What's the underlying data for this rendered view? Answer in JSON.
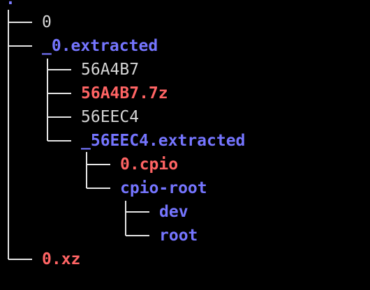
{
  "tree": {
    "root": ".",
    "nodes": [
      {
        "id": "n0",
        "name": "0",
        "kind": "file"
      },
      {
        "id": "n1",
        "name": "_0.extracted",
        "kind": "dir"
      },
      {
        "id": "n2",
        "name": "56A4B7",
        "kind": "file"
      },
      {
        "id": "n3",
        "name": "56A4B7.7z",
        "kind": "archive"
      },
      {
        "id": "n4",
        "name": "56EEC4",
        "kind": "file"
      },
      {
        "id": "n5",
        "name": "_56EEC4.extracted",
        "kind": "dir"
      },
      {
        "id": "n6",
        "name": "0.cpio",
        "kind": "archive"
      },
      {
        "id": "n7",
        "name": "cpio-root",
        "kind": "dir"
      },
      {
        "id": "n8",
        "name": "dev",
        "kind": "dir"
      },
      {
        "id": "n9",
        "name": "root",
        "kind": "dir"
      },
      {
        "id": "n10",
        "name": "0.xz",
        "kind": "archive"
      }
    ]
  },
  "colors": {
    "background": "#000000",
    "file": "#d4d4d4",
    "dir": "#7575ff",
    "archive": "#ff6464",
    "tree_line": "#e6e6e6"
  }
}
